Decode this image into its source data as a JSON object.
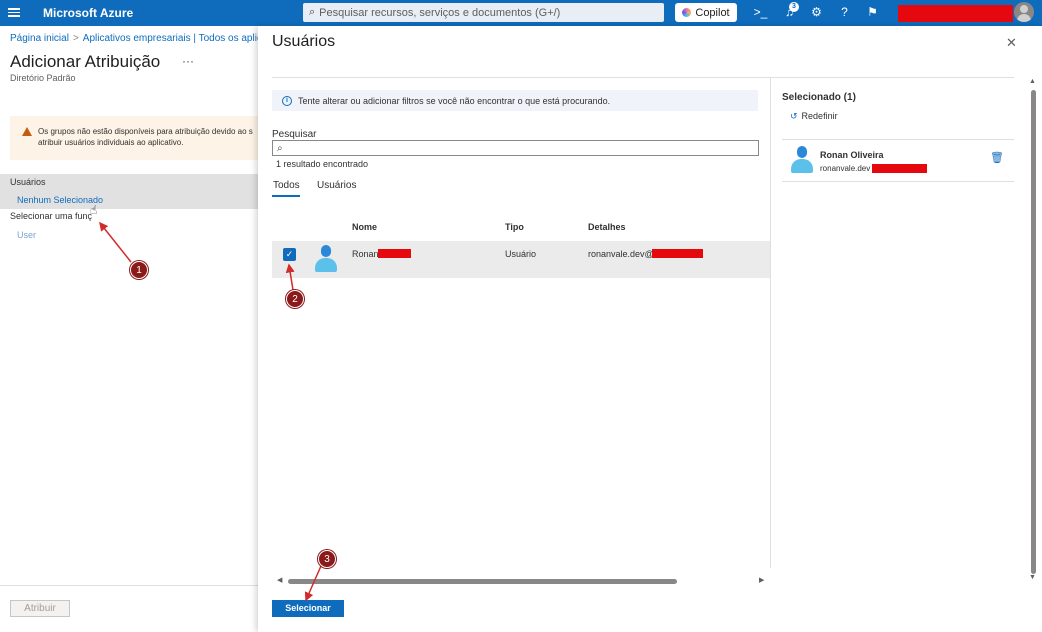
{
  "topbar": {
    "brand": "Microsoft Azure",
    "search_placeholder": "Pesquisar recursos, serviços e documentos (G+/)",
    "copilot_label": "Copilot",
    "notification_count": "3",
    "icons": [
      "menu-icon",
      "search-icon",
      "terminal-icon",
      "bell-icon",
      "gear-icon",
      "help-icon",
      "feedback-icon",
      "avatar"
    ],
    "accent_color": "#0f6cbd"
  },
  "background_page": {
    "breadcrumb": [
      "Página inicial",
      "Aplicativos empresariais | Todos os aplicativ"
    ],
    "title": "Adicionar Atribuição",
    "more_label": "···",
    "subtitle": "Diretório Padrão",
    "warning_text_line1": "Os grupos não estão disponíveis para atribuição devido ao s",
    "warning_text_line2": "atribuir usuários individuais ao aplicativo.",
    "users_label": "Usuários",
    "users_value": "Nenhum Selecionado",
    "role_label": "Selecionar uma funç",
    "role_value": "User",
    "assign_button": "Atribuir"
  },
  "panel": {
    "title": "Usuários",
    "close_label": "✕",
    "info_text": "Tente alterar ou adicionar filtros se você não encontrar o que está procurando.",
    "search_label": "Pesquisar",
    "search_value": "",
    "result_count": "1 resultado encontrado",
    "tabs": [
      {
        "label": "Todos",
        "active": true
      },
      {
        "label": "Usuários",
        "active": false
      }
    ],
    "columns": [
      "Nome",
      "Tipo",
      "Detalhes"
    ],
    "rows": [
      {
        "name": "Ronan",
        "type": "Usuário",
        "details": "ronanvale.dev@",
        "checked": true
      }
    ],
    "selected": {
      "title": "Selecionado (1)",
      "reset_label": "Redefinir",
      "items": [
        {
          "name": "Ronan Oliveira",
          "email": "ronanvale.dev"
        }
      ]
    },
    "select_button": "Selecionar"
  },
  "annotations": {
    "markers": [
      "1",
      "2",
      "3"
    ],
    "color": "#8b1a1a",
    "redaction_color": "#e5090f"
  }
}
